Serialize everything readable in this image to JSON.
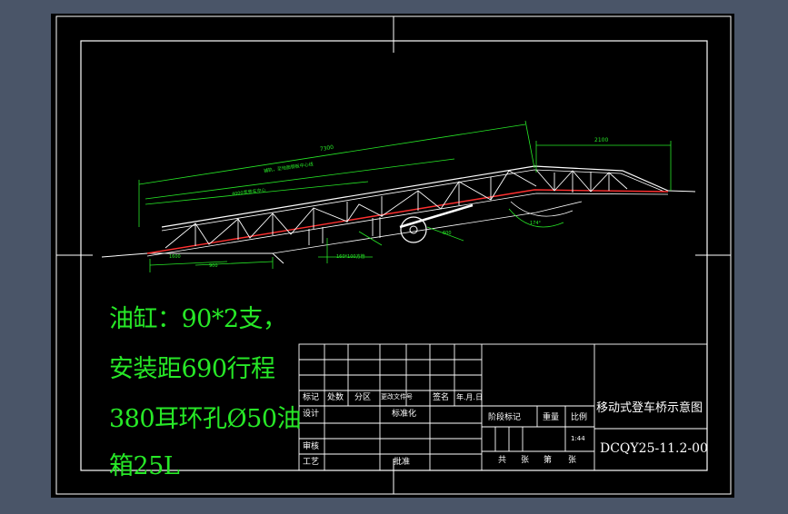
{
  "notes": [
    "油缸：90*2支，",
    "安装距690行程",
    "380耳环孔Ø50油",
    "箱25L"
  ],
  "title_block": {
    "drawing_title": "移动式登车桥示意图",
    "drawing_number": "DCQY25-11.2-00",
    "scale": "1:44",
    "row_labels": {
      "biaoji": "标记",
      "chushu": "处数",
      "fenqu": "分区",
      "gengai": "更改文件号",
      "qianming": "签名",
      "nianyueri": "年.月.日",
      "sheji": "设计",
      "biaozhunhua": "标准化",
      "shenhe": "审核",
      "gongyi": "工艺",
      "pizhun": "批准"
    },
    "stage_labels": {
      "jieduan": "阶段标记",
      "zhongliang": "重量",
      "bili": "比例"
    },
    "sheet_labels": {
      "gong1": "共",
      "zhang1": "张",
      "di": "第",
      "zhang2": "张"
    }
  },
  "dimensions": {
    "d1": "7300",
    "d2": "2100",
    "d3": "4000",
    "d4": "1600",
    "d5": "900",
    "d6": "600",
    "ann1": "铺轨，至地面钢板中心线",
    "ann2": "4000宽登车中心",
    "ann3": "160*100方管",
    "angle": "174°"
  }
}
